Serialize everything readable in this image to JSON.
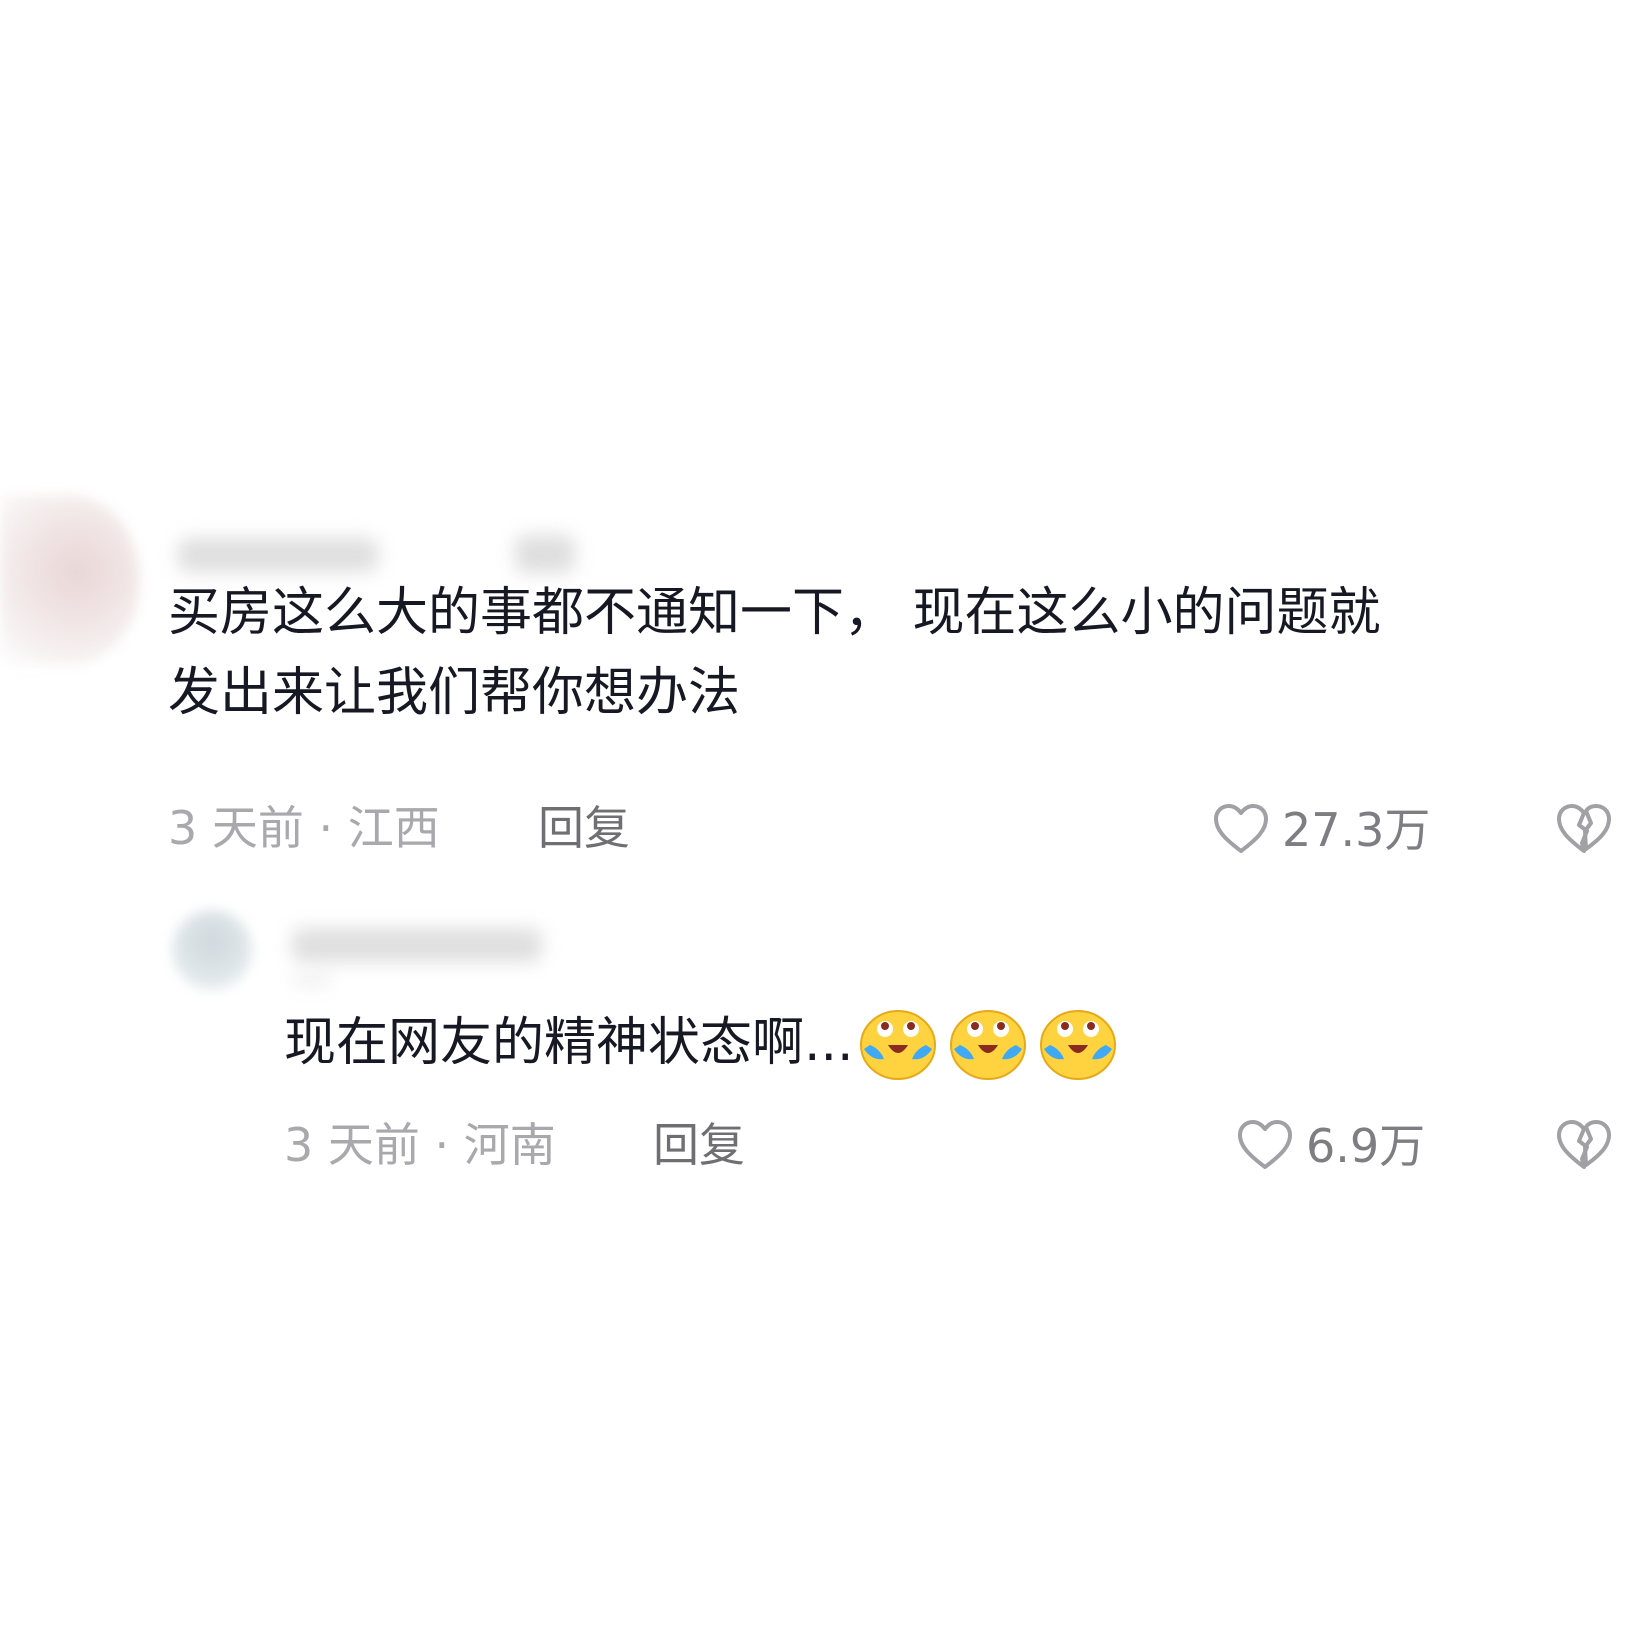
{
  "comments": [
    {
      "text_line1": "买房这么大的事都不通知一下， 现在这么小的问题就",
      "text_line2": "发出来让我们帮你想办法",
      "time_location": "3 天前 · 江西",
      "reply_label": "回复",
      "likes": "27.3万",
      "icons": [
        "heart-outline-icon",
        "broken-heart-icon"
      ]
    },
    {
      "text": "现在网友的精神状态啊...",
      "emoji_count": 3,
      "emoji_name": "crying-laughing-emoji",
      "time_location": "3 天前 · 河南",
      "reply_label": "回复",
      "likes": "6.9万",
      "icons": [
        "heart-outline-icon",
        "broken-heart-icon"
      ]
    }
  ],
  "colors": {
    "text": "#161823",
    "meta": "#a8a8ad",
    "reply": "#6f6f73",
    "icon": "#a0a0a5",
    "emoji_face": "#ffd23f",
    "emoji_tears": "#3fa9f5"
  }
}
